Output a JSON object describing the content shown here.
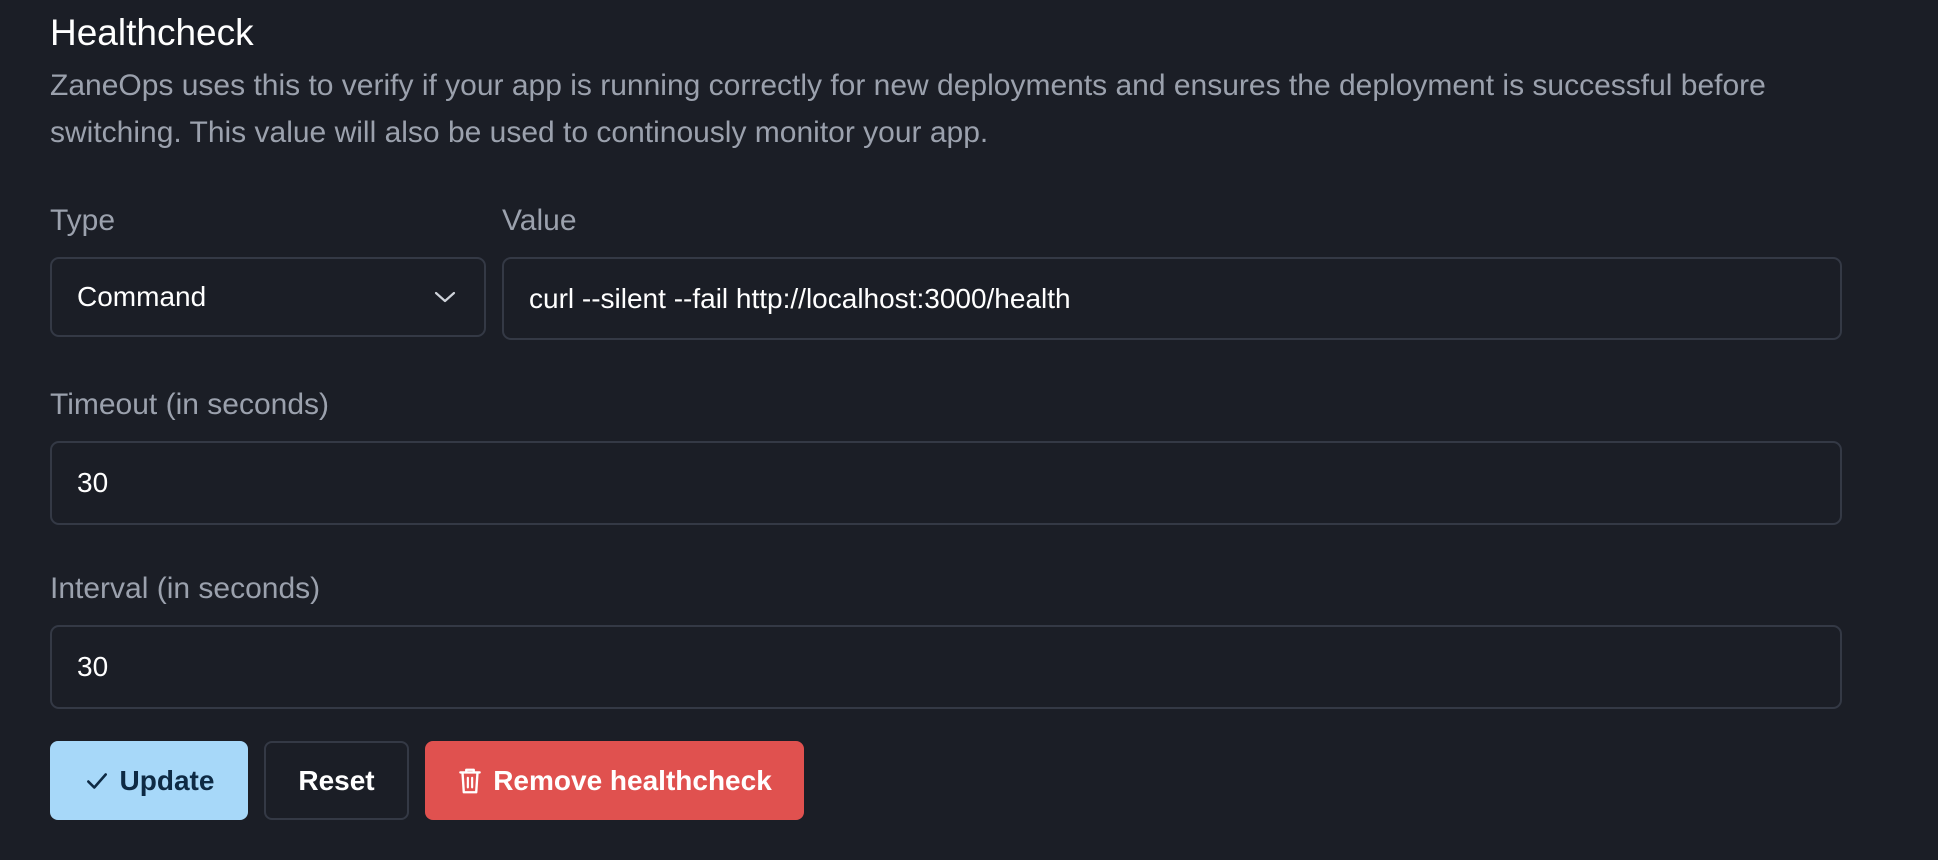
{
  "section": {
    "title": "Healthcheck",
    "description": "ZaneOps uses this to verify if your app is running correctly for new deployments and ensures the deployment is successful before switching. This value will also be used to continously monitor your app."
  },
  "form": {
    "type": {
      "label": "Type",
      "selected": "Command",
      "icon": "chevron-down-icon"
    },
    "value": {
      "label": "Value",
      "value": "curl --silent --fail http://localhost:3000/health"
    },
    "timeout": {
      "label": "Timeout (in seconds)",
      "value": "30"
    },
    "interval": {
      "label": "Interval (in seconds)",
      "value": "30"
    }
  },
  "actions": {
    "update_label": "Update",
    "update_icon": "check-icon",
    "reset_label": "Reset",
    "remove_label": "Remove healthcheck",
    "remove_icon": "trash-icon"
  },
  "colors": {
    "background": "#1b1e26",
    "border": "#343945",
    "muted_text": "#9ba1ad",
    "primary": "#a7d8f9",
    "danger": "#e0514f"
  }
}
